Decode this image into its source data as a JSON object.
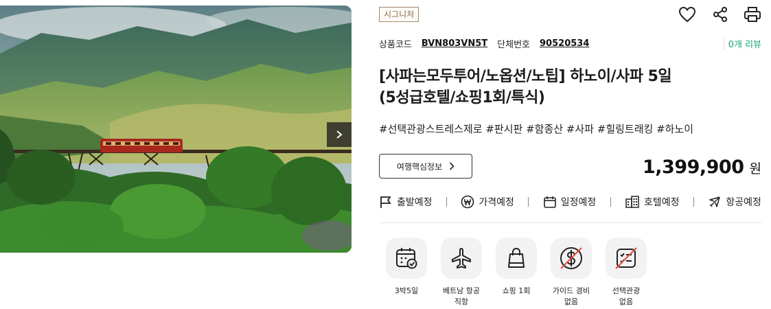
{
  "hero": {
    "next_icon": "chevron-right-icon"
  },
  "product": {
    "badge": "시그니처",
    "code_label": "상품코드",
    "code_value": "BVN803VN5T",
    "group_label": "단체번호",
    "group_value": "90520534",
    "reviews": "0개 리뷰",
    "title_line1": "[사파는모두투어/노옵션/노팁] 하노이/사파 5일",
    "title_line2": "(5성급호텔/쇼핑1회/특식)",
    "tags": "#선택관광스트레스제로 #판시판 #함종산 #사파 #힐링트래킹 #하노이"
  },
  "actions": {
    "key_info_label": "여행핵심정보",
    "icons": [
      "heart-icon",
      "share-icon",
      "print-icon"
    ]
  },
  "price": {
    "amount": "1,399,900",
    "unit": "원"
  },
  "alerts": [
    {
      "label": "출발예정",
      "icon": "flag-icon"
    },
    {
      "label": "가격예정",
      "icon": "won-icon"
    },
    {
      "label": "일정예정",
      "icon": "calendar-icon"
    },
    {
      "label": "호텔예정",
      "icon": "hotel-icon"
    },
    {
      "label": "항공예정",
      "icon": "airplane-icon"
    }
  ],
  "features": [
    {
      "label": "3박5일",
      "icon": "calendar-check-icon"
    },
    {
      "label": "베트남 항공\n직항",
      "icon": "airplane-icon"
    },
    {
      "label": "쇼핑 1회",
      "icon": "shopping-bag-icon"
    },
    {
      "label": "가이드 경비\n없음",
      "icon": "no-dollar-icon"
    },
    {
      "label": "선택관광\n없음",
      "icon": "no-optional-tour-icon"
    }
  ],
  "colors": {
    "badge_border": "#a08a6c",
    "review_green": "#17a37a",
    "strike_red": "#e84a3c"
  }
}
